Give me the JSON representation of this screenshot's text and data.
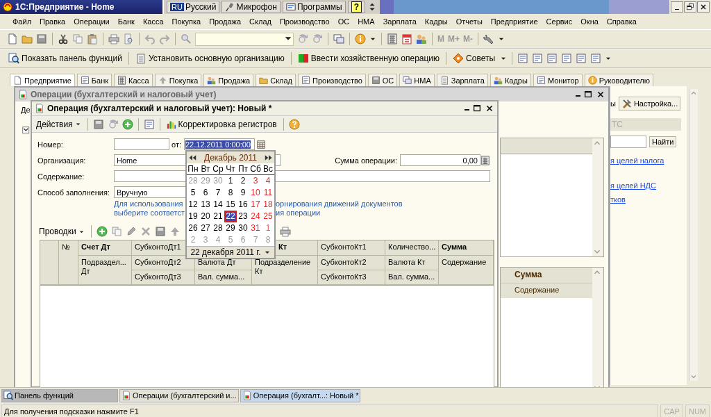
{
  "app_window": {
    "title": "1С:Предприятие - Home"
  },
  "language_bar": {
    "code": "RU",
    "language": "Русский",
    "items": [
      "Микрофон",
      "Программы"
    ],
    "help": "?"
  },
  "menu": [
    "Файл",
    "Правка",
    "Операции",
    "Банк",
    "Касса",
    "Покупка",
    "Продажа",
    "Склад",
    "Производство",
    "ОС",
    "НМА",
    "Зарплата",
    "Кадры",
    "Отчеты",
    "Предприятие",
    "Сервис",
    "Окна",
    "Справка"
  ],
  "memory_buttons": [
    "M",
    "M+",
    "M-"
  ],
  "command_bar": [
    "Показать панель функций",
    "Установить основную организацию",
    "Ввести хозяйственную операцию",
    "Советы"
  ],
  "section_tabs": [
    {
      "label": "Предприятие",
      "selected": true
    },
    {
      "label": "Банк",
      "selected": false
    },
    {
      "label": "Касса",
      "selected": false
    },
    {
      "label": "Покупка",
      "selected": false
    },
    {
      "label": "Продажа",
      "selected": false
    },
    {
      "label": "Склад",
      "selected": false
    },
    {
      "label": "Производство",
      "selected": false
    },
    {
      "label": "ОС",
      "selected": false
    },
    {
      "label": "НМА",
      "selected": false
    },
    {
      "label": "Зарплата",
      "selected": false
    },
    {
      "label": "Кадры",
      "selected": false
    },
    {
      "label": "Монитор",
      "selected": false
    },
    {
      "label": "Руководителю",
      "selected": false
    }
  ],
  "background_panel": {
    "fragment": "ы",
    "settings_button": "Настройка...",
    "section_header": "ТС",
    "search_button": "Найти",
    "links": [
      "я целей налога",
      "я целей НДС",
      "тков"
    ]
  },
  "operations_window": {
    "title": "Операции (бухгалтерский и налоговый учет)",
    "fragment": "Де",
    "sum_header": "Сумма",
    "content_header": "Содержание"
  },
  "operation_form": {
    "title": "Операция (бухгалтерский и налоговый учет): Новый *",
    "actions_menu": "Действия",
    "register_button": "Корректировка регистров",
    "number_label": "Номер:",
    "date_label": "от:",
    "date": "22.12.2011  0:00:00",
    "organization_label": "Организация:",
    "organization": "Home",
    "amount_label": "Сумма операции:",
    "amount": "0,00",
    "content_label": "Содержание:",
    "fill_label": "Способ заполнения:",
    "fill_method": "Вручную",
    "hint_lines": [
      [
        "Для использования",
        "орнирования движений документов"
      ],
      [
        "выберите соответст",
        "ия операции"
      ]
    ],
    "entries_menu": "Проводки",
    "entries_columns": [
      {
        "cells": [
          {}
        ]
      },
      {
        "cells": [
          {
            "text": "№"
          }
        ]
      },
      {
        "cells": [
          {
            "text": "Счет Дт",
            "bold": true
          },
          {
            "text": "Подраздел... Дт"
          }
        ]
      },
      {
        "cells": [
          {
            "text": "СубконтоДт1"
          },
          {
            "text": "СубконтоДт2"
          },
          {
            "text": "СубконтоДт3"
          }
        ]
      },
      {
        "cells": [
          {},
          {
            "text": "Валюта Дт"
          },
          {
            "text": "Вал. сумма..."
          }
        ]
      },
      {
        "cells": [
          {
            "text": "Кт",
            "bold": true,
            "partly_covered": true
          },
          {
            "text": "Подразделение Кт"
          }
        ]
      },
      {
        "cells": [
          {
            "text": "СубконтоКт1"
          },
          {
            "text": "СубконтоКт2"
          },
          {
            "text": "СубконтоКт3"
          }
        ]
      },
      {
        "cells": [
          {
            "text": "Количество..."
          },
          {
            "text": "Валюта Кт"
          },
          {
            "text": "Вал. сумма..."
          }
        ]
      },
      {
        "cells": [
          {
            "text": "Сумма",
            "bold": true
          },
          {
            "text": "Содержание"
          }
        ]
      }
    ]
  },
  "calendar": {
    "month": "Декабрь 2011",
    "weekdays": [
      "Пн",
      "Вт",
      "Ср",
      "Чт",
      "Пт",
      "Сб",
      "Вс"
    ],
    "footer": "22 декабря 2011 г.",
    "days": [
      {
        "day": "28",
        "kind": "other",
        "selected": false
      },
      {
        "day": "29",
        "kind": "other",
        "selected": false
      },
      {
        "day": "30",
        "kind": "other",
        "selected": false
      },
      {
        "day": "1",
        "kind": "day",
        "selected": false
      },
      {
        "day": "2",
        "kind": "day",
        "selected": false
      },
      {
        "day": "3",
        "kind": "weekend",
        "selected": false
      },
      {
        "day": "4",
        "kind": "weekend",
        "selected": false
      },
      {
        "day": "5",
        "kind": "day",
        "selected": false
      },
      {
        "day": "6",
        "kind": "day",
        "selected": false
      },
      {
        "day": "7",
        "kind": "day",
        "selected": false
      },
      {
        "day": "8",
        "kind": "day",
        "selected": false
      },
      {
        "day": "9",
        "kind": "day",
        "selected": false
      },
      {
        "day": "10",
        "kind": "weekend",
        "selected": false
      },
      {
        "day": "11",
        "kind": "weekend",
        "selected": false
      },
      {
        "day": "12",
        "kind": "day",
        "selected": false
      },
      {
        "day": "13",
        "kind": "day",
        "selected": false
      },
      {
        "day": "14",
        "kind": "day",
        "selected": false
      },
      {
        "day": "15",
        "kind": "day",
        "selected": false
      },
      {
        "day": "16",
        "kind": "day",
        "selected": false
      },
      {
        "day": "17",
        "kind": "weekend",
        "selected": false
      },
      {
        "day": "18",
        "kind": "weekend",
        "selected": false
      },
      {
        "day": "19",
        "kind": "day",
        "selected": false
      },
      {
        "day": "20",
        "kind": "day",
        "selected": false
      },
      {
        "day": "21",
        "kind": "day",
        "selected": false
      },
      {
        "day": "22",
        "kind": "day",
        "selected": true
      },
      {
        "day": "23",
        "kind": "day",
        "selected": false
      },
      {
        "day": "24",
        "kind": "weekend",
        "selected": false
      },
      {
        "day": "25",
        "kind": "weekend",
        "selected": false
      },
      {
        "day": "26",
        "kind": "day",
        "selected": false
      },
      {
        "day": "27",
        "kind": "day",
        "selected": false
      },
      {
        "day": "28",
        "kind": "day",
        "selected": false
      },
      {
        "day": "29",
        "kind": "day",
        "selected": false
      },
      {
        "day": "30",
        "kind": "day",
        "selected": false
      },
      {
        "day": "31",
        "kind": "weekend",
        "selected": false
      },
      {
        "day": "1",
        "kind": "other_weekend",
        "selected": false
      },
      {
        "day": "2",
        "kind": "other",
        "selected": false
      },
      {
        "day": "3",
        "kind": "other",
        "selected": false
      },
      {
        "day": "4",
        "kind": "other",
        "selected": false
      },
      {
        "day": "5",
        "kind": "other",
        "selected": false
      },
      {
        "day": "6",
        "kind": "other",
        "selected": false
      },
      {
        "day": "7",
        "kind": "other",
        "selected": false
      },
      {
        "day": "8",
        "kind": "other",
        "selected": false
      }
    ]
  },
  "taskbar": [
    {
      "label": "Панель функций",
      "selected": false
    },
    {
      "label": "Операции (бухгалтерский и...",
      "selected": false
    },
    {
      "label": "Операция (бухгалт...: Новый *",
      "selected": true
    }
  ],
  "status_bar": {
    "hint": "Для получения подсказки нажмите F1",
    "indicators": [
      {
        "label": "CAP",
        "on": false
      },
      {
        "label": "NUM",
        "on": false
      }
    ]
  }
}
